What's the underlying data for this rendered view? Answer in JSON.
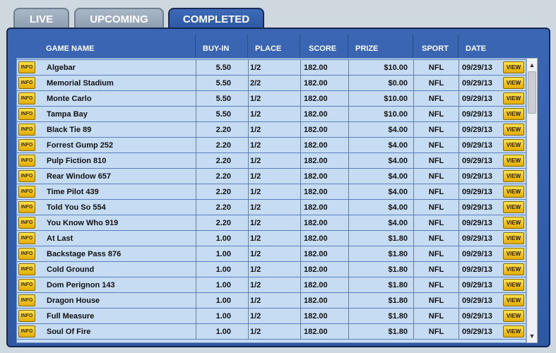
{
  "tabs": [
    {
      "label": "LIVE"
    },
    {
      "label": "UPCOMING"
    },
    {
      "label": "COMPLETED"
    }
  ],
  "table": {
    "headers": {
      "game_name": "GAME NAME",
      "buy_in": "BUY-IN",
      "place": "PLACE",
      "score": "SCORE",
      "prize": "PRIZE",
      "sport": "SPORT",
      "date": "DATE"
    },
    "info_label": "INFO",
    "view_label": "VIEW",
    "rows": [
      {
        "name": "Algebar",
        "buyin": "5.50",
        "place": "1/2",
        "score": "182.00",
        "prize": "$10.00",
        "sport": "NFL",
        "date": "09/29/13"
      },
      {
        "name": "Memorial Stadium",
        "buyin": "5.50",
        "place": "2/2",
        "score": "182.00",
        "prize": "$0.00",
        "sport": "NFL",
        "date": "09/29/13"
      },
      {
        "name": "Monte Carlo",
        "buyin": "5.50",
        "place": "1/2",
        "score": "182.00",
        "prize": "$10.00",
        "sport": "NFL",
        "date": "09/29/13"
      },
      {
        "name": "Tampa Bay",
        "buyin": "5.50",
        "place": "1/2",
        "score": "182.00",
        "prize": "$10.00",
        "sport": "NFL",
        "date": "09/29/13"
      },
      {
        "name": "Black Tie 89",
        "buyin": "2.20",
        "place": "1/2",
        "score": "182.00",
        "prize": "$4.00",
        "sport": "NFL",
        "date": "09/29/13"
      },
      {
        "name": "Forrest Gump 252",
        "buyin": "2.20",
        "place": "1/2",
        "score": "182.00",
        "prize": "$4.00",
        "sport": "NFL",
        "date": "09/29/13"
      },
      {
        "name": "Pulp Fiction 810",
        "buyin": "2.20",
        "place": "1/2",
        "score": "182.00",
        "prize": "$4.00",
        "sport": "NFL",
        "date": "09/29/13"
      },
      {
        "name": "Rear Window 657",
        "buyin": "2.20",
        "place": "1/2",
        "score": "182.00",
        "prize": "$4.00",
        "sport": "NFL",
        "date": "09/29/13"
      },
      {
        "name": "Time Pilot 439",
        "buyin": "2.20",
        "place": "1/2",
        "score": "182.00",
        "prize": "$4.00",
        "sport": "NFL",
        "date": "09/29/13"
      },
      {
        "name": "Told You So 554",
        "buyin": "2.20",
        "place": "1/2",
        "score": "182.00",
        "prize": "$4.00",
        "sport": "NFL",
        "date": "09/29/13"
      },
      {
        "name": "You Know Who 919",
        "buyin": "2.20",
        "place": "1/2",
        "score": "182.00",
        "prize": "$4.00",
        "sport": "NFL",
        "date": "09/29/13"
      },
      {
        "name": "At Last",
        "buyin": "1.00",
        "place": "1/2",
        "score": "182.00",
        "prize": "$1.80",
        "sport": "NFL",
        "date": "09/29/13"
      },
      {
        "name": "Backstage Pass 876",
        "buyin": "1.00",
        "place": "1/2",
        "score": "182.00",
        "prize": "$1.80",
        "sport": "NFL",
        "date": "09/29/13"
      },
      {
        "name": "Cold Ground",
        "buyin": "1.00",
        "place": "1/2",
        "score": "182.00",
        "prize": "$1.80",
        "sport": "NFL",
        "date": "09/29/13"
      },
      {
        "name": "Dom Perignon 143",
        "buyin": "1.00",
        "place": "1/2",
        "score": "182.00",
        "prize": "$1.80",
        "sport": "NFL",
        "date": "09/29/13"
      },
      {
        "name": "Dragon House",
        "buyin": "1.00",
        "place": "1/2",
        "score": "182.00",
        "prize": "$1.80",
        "sport": "NFL",
        "date": "09/29/13"
      },
      {
        "name": "Full Measure",
        "buyin": "1.00",
        "place": "1/2",
        "score": "182.00",
        "prize": "$1.80",
        "sport": "NFL",
        "date": "09/29/13"
      },
      {
        "name": "Soul Of Fire",
        "buyin": "1.00",
        "place": "1/2",
        "score": "182.00",
        "prize": "$1.80",
        "sport": "NFL",
        "date": "09/29/13"
      }
    ]
  },
  "scrollbar": {
    "up_icon": "chevron-up-icon",
    "down_icon": "chevron-down-icon"
  },
  "colors": {
    "panel": "#2d58a4",
    "row_bg": "#c6dcf3",
    "button": "#f2c200",
    "tab_active": "#2c57a3"
  }
}
